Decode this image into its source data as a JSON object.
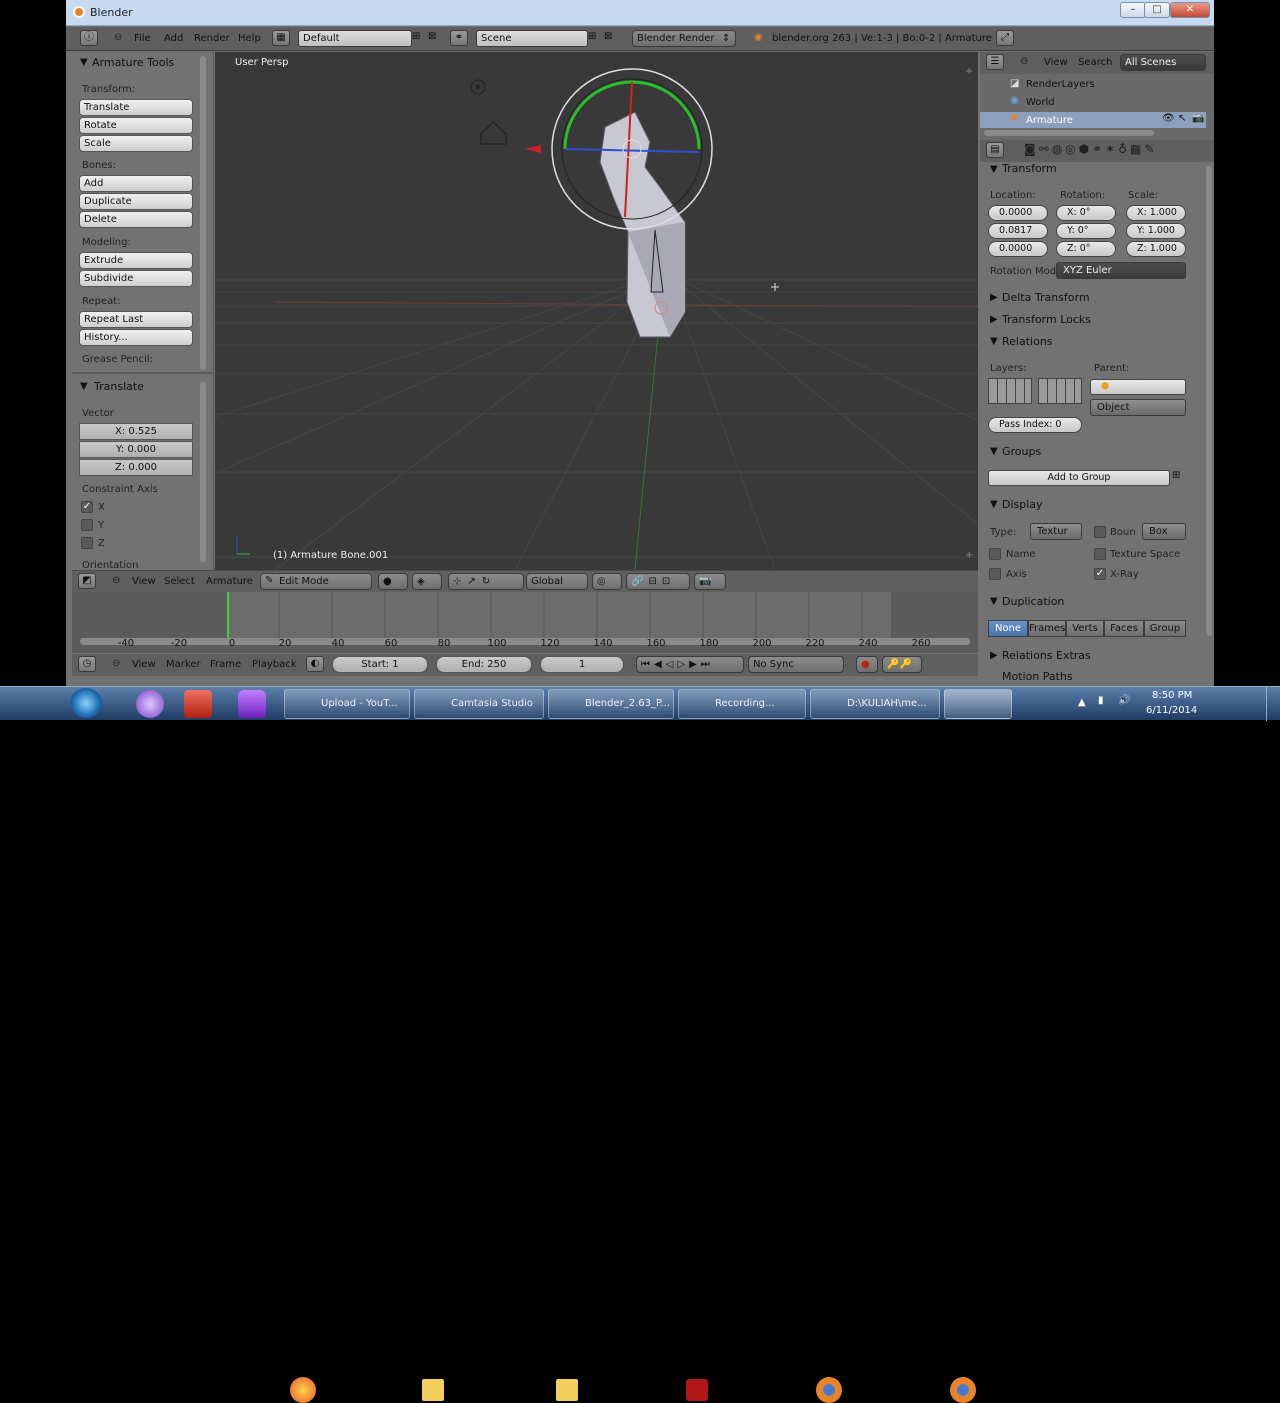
{
  "window": {
    "title": "Blender"
  },
  "infobar": {
    "menus": [
      "File",
      "Add",
      "Render",
      "Help"
    ],
    "layout": "Default",
    "scene": "Scene",
    "engine": "Blender Render",
    "stats": "blender.org 263 | Ve:1-3 | Bo:0-2 | Armature"
  },
  "toolshelf": {
    "title": "Armature Tools",
    "transform_label": "Transform:",
    "translate": "Translate",
    "rotate": "Rotate",
    "scale": "Scale",
    "bones_label": "Bones:",
    "add": "Add",
    "duplicate": "Duplicate",
    "delete": "Delete",
    "modeling_label": "Modeling:",
    "extrude": "Extrude",
    "subdivide": "Subdivide",
    "repeat_label": "Repeat:",
    "repeat_last": "Repeat Last",
    "history": "History...",
    "grease_label": "Grease Pencil:"
  },
  "operator": {
    "title": "Translate",
    "vector_label": "Vector",
    "x": "X: 0.525",
    "y": "Y: 0.000",
    "z": "Z: 0.000",
    "constraint_label": "Constraint Axis",
    "axes": [
      "X",
      "Y",
      "Z"
    ],
    "orientation_label": "Orientation"
  },
  "viewport": {
    "label": "User Persp",
    "object_label": "(1) Armature Bone.001"
  },
  "view3d_header": {
    "menus": [
      "View",
      "Select",
      "Armature"
    ],
    "mode": "Edit Mode",
    "orientation": "Global"
  },
  "timeline": {
    "ticks": [
      "-40",
      "-20",
      "0",
      "20",
      "40",
      "60",
      "80",
      "100",
      "120",
      "140",
      "160",
      "180",
      "200",
      "220",
      "240",
      "260"
    ],
    "current_frame": 1
  },
  "timeline_header": {
    "menus": [
      "View",
      "Marker",
      "Frame",
      "Playback"
    ],
    "start": "Start: 1",
    "end": "End: 250",
    "frame": "1",
    "sync": "No Sync"
  },
  "outliner": {
    "view": "View",
    "search": "Search",
    "scenes": "All Scenes",
    "items": [
      "RenderLayers",
      "World",
      "Armature"
    ]
  },
  "properties": {
    "transform_title": "Transform",
    "location_label": "Location:",
    "rotation_label": "Rotation:",
    "scale_label": "Scale:",
    "location": [
      "0.0000",
      "0.0817",
      "0.0000"
    ],
    "rotation": [
      "X: 0°",
      "Y: 0°",
      "Z: 0°"
    ],
    "scale": [
      "X: 1.000",
      "Y: 1.000",
      "Z: 1.000"
    ],
    "rotation_mode_label": "Rotation Mod",
    "rotation_mode": "XYZ Euler",
    "delta_transform": "Delta Transform",
    "transform_locks": "Transform Locks",
    "relations": "Relations",
    "layers_label": "Layers:",
    "parent_label": "Parent:",
    "parent_type": "Object",
    "pass_index": "Pass Index: 0",
    "groups": "Groups",
    "add_to_group": "Add to Group",
    "display": "Display",
    "type_label": "Type:",
    "type_value": "Textur",
    "bound": "Boun",
    "bound_type": "Box",
    "name": "Name",
    "texture_space": "Texture Space",
    "axis": "Axis",
    "xray": "X-Ray",
    "duplication": "Duplication",
    "dup_tabs": [
      "None",
      "Frames",
      "Verts",
      "Faces",
      "Group"
    ],
    "relations_extras": "Relations Extras",
    "motion_paths": "Motion Paths"
  },
  "taskbar": {
    "items": [
      "Upload - YouT...",
      "Camtasia Studio",
      "Blender_2.63_P...",
      "Recording...",
      "D:\\KULIAH\\me..."
    ],
    "time": "8:50 PM",
    "date": "6/11/2014"
  }
}
